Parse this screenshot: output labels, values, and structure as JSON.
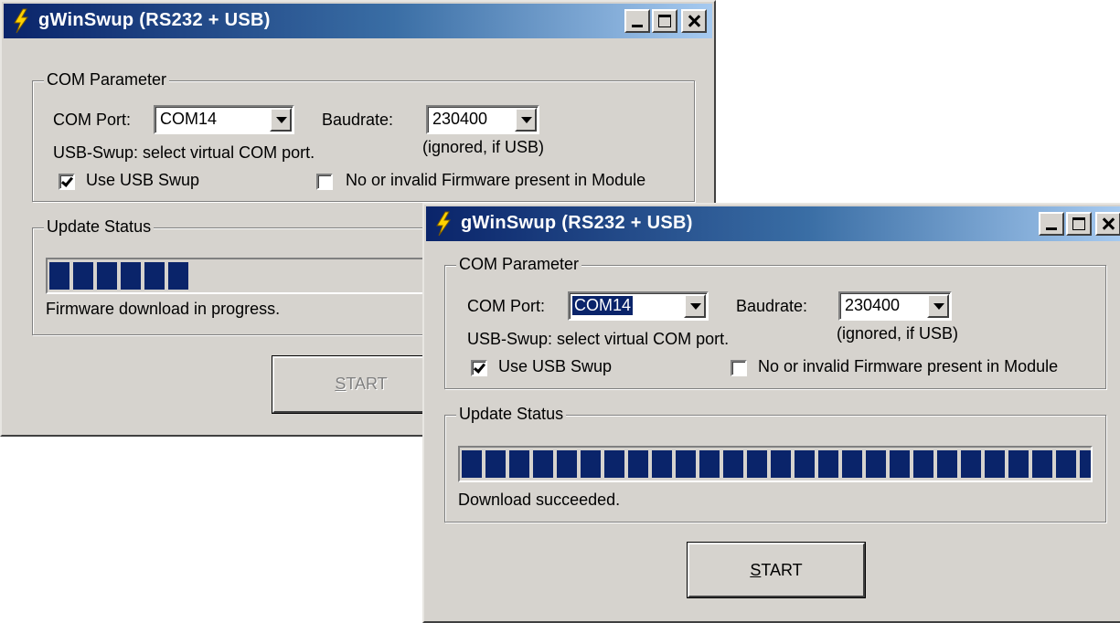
{
  "windows": [
    {
      "title": "gWinSwup (RS232 + USB)",
      "com_group_label": "COM Parameter",
      "com_port_label": "COM Port:",
      "com_port_value": "COM14",
      "baudrate_label": "Baudrate:",
      "baudrate_value": "230400",
      "usb_hint": "USB-Swup: select virtual COM port.",
      "baud_hint": "(ignored, if USB)",
      "use_usb_label": "Use USB Swup",
      "use_usb_checked": true,
      "no_firmware_label": "No or invalid Firmware present in Module",
      "no_firmware_checked": false,
      "status_group_label": "Update Status",
      "progress_segments": 6,
      "status_text": "Firmware download in progress.",
      "start_label": "START",
      "start_enabled": false
    },
    {
      "title": "gWinSwup (RS232 + USB)",
      "com_group_label": "COM Parameter",
      "com_port_label": "COM Port:",
      "com_port_value": "COM14",
      "baudrate_label": "Baudrate:",
      "baudrate_value": "230400",
      "usb_hint": "USB-Swup: select virtual COM port.",
      "baud_hint": "(ignored, if USB)",
      "use_usb_label": "Use USB Swup",
      "use_usb_checked": true,
      "no_firmware_label": "No or invalid Firmware present in Module",
      "no_firmware_checked": false,
      "status_group_label": "Update Status",
      "progress_segments": 27,
      "status_text": "Download succeeded.",
      "start_label": "START",
      "start_enabled": true
    }
  ]
}
